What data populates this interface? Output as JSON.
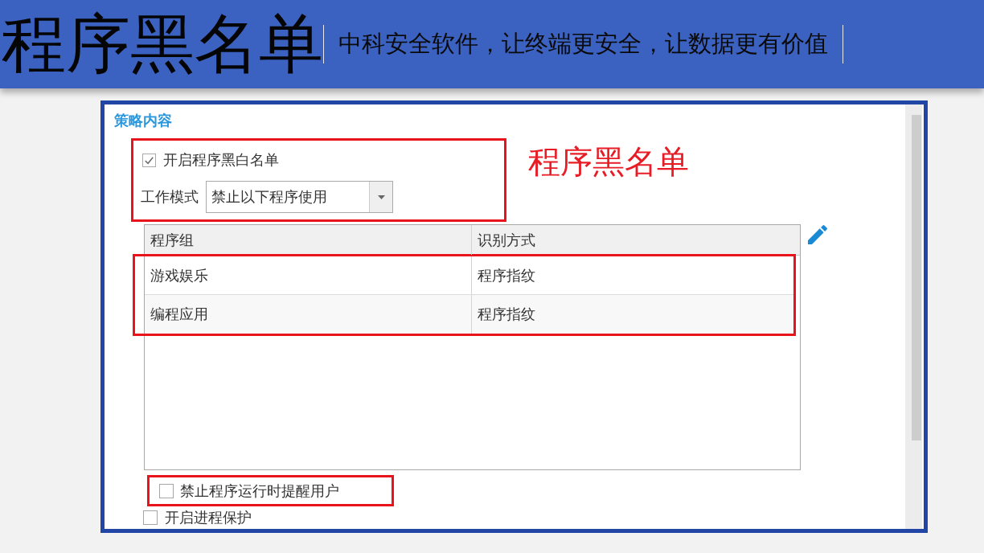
{
  "header": {
    "title": "程序黑名单",
    "slogan": "中科安全软件，让终端更安全，让数据更有价值"
  },
  "panel": {
    "section_title": "策略内容",
    "enable_option": {
      "label": "开启程序黑白名单",
      "checked": true
    },
    "work_mode": {
      "label": "工作模式",
      "value": "禁止以下程序使用"
    },
    "annotation_label": "程序黑名单",
    "table": {
      "columns": [
        "程序组",
        "识别方式"
      ],
      "rows": [
        {
          "cells": [
            "游戏娱乐",
            "程序指纹"
          ]
        },
        {
          "cells": [
            "编程应用",
            "程序指纹"
          ]
        }
      ]
    },
    "options": [
      {
        "label": "禁止程序运行时提醒用户",
        "checked": false
      },
      {
        "label": "开启进程保护",
        "checked": false
      }
    ]
  }
}
